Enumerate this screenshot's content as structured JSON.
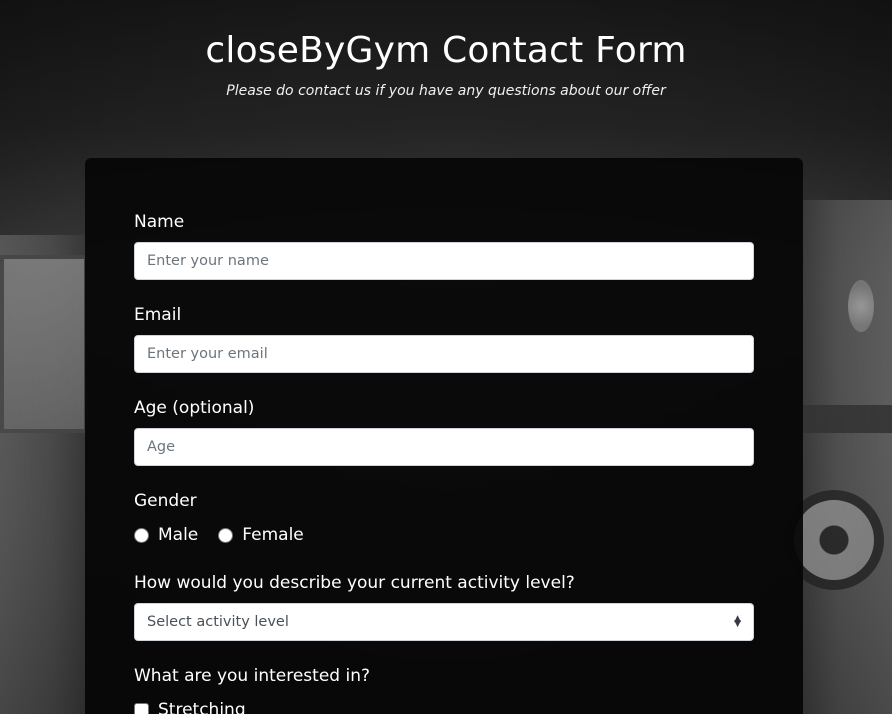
{
  "header": {
    "title": "closeByGym Contact Form",
    "subtitle": "Please do contact us if you have any questions about our offer"
  },
  "form": {
    "name": {
      "label": "Name",
      "placeholder": "Enter your name",
      "value": ""
    },
    "email": {
      "label": "Email",
      "placeholder": "Enter your email",
      "value": ""
    },
    "age": {
      "label": "Age (optional)",
      "placeholder": "Age",
      "value": ""
    },
    "gender": {
      "label": "Gender",
      "options": [
        {
          "label": "Male",
          "selected": false
        },
        {
          "label": "Female",
          "selected": false
        }
      ]
    },
    "activity": {
      "label": "How would you describe your current activity level?",
      "selected": "Select activity level",
      "icon": "select-arrows-icon"
    },
    "interests": {
      "label": "What are you interested in?",
      "options": [
        {
          "label": "Stretching",
          "checked": false
        }
      ]
    }
  },
  "colors": {
    "card_background": "#060606",
    "text": "#ffffff",
    "input_border": "#ced4da",
    "placeholder": "#6c757d"
  }
}
